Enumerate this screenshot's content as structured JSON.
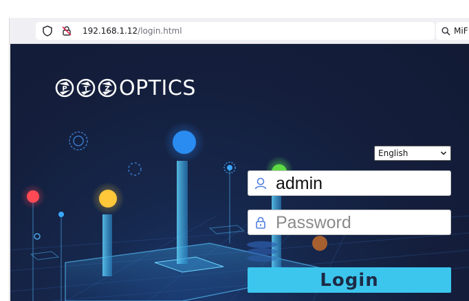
{
  "browser": {
    "url_host": "192.168.1.12",
    "url_path": "/login.html",
    "search_text": "MiF"
  },
  "logo": {
    "text": "OPTICS"
  },
  "login": {
    "language_selected": "English",
    "username_value": "admin",
    "password_placeholder": "Password",
    "login_label": "Login"
  },
  "colors": {
    "accent": "#3cc6ee",
    "background": "#141f3d"
  },
  "icons": {
    "site_info": "shield-icon",
    "permissions": "connection-slash-icon",
    "bookmark": "star-icon",
    "search": "search-icon",
    "user": "user-icon",
    "password": "lock-icon"
  }
}
